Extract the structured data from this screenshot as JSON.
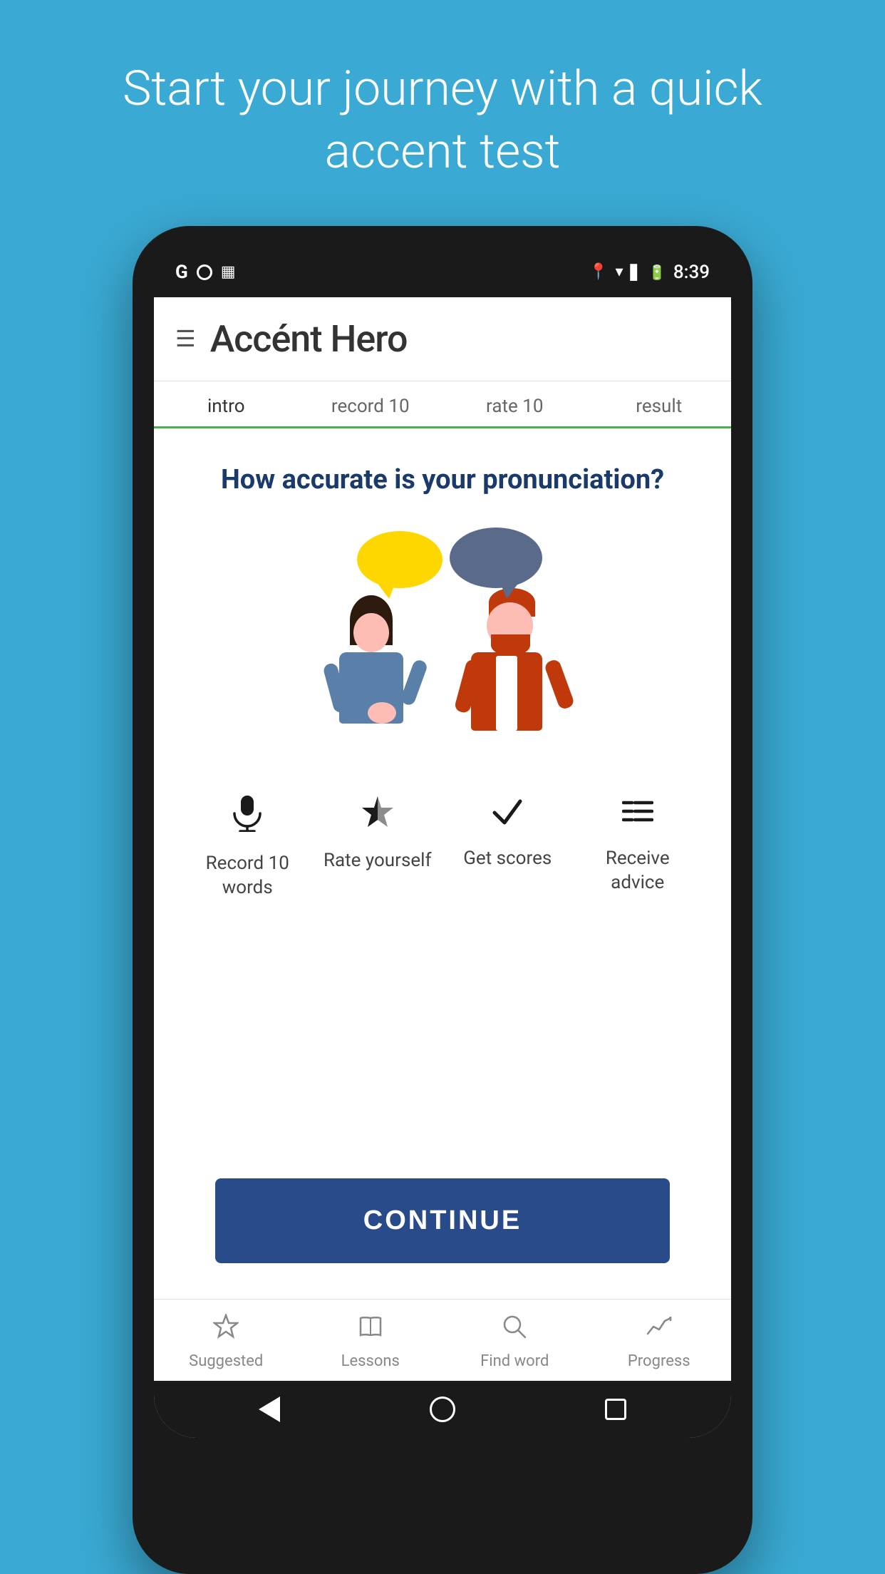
{
  "page": {
    "top_text": "Start your journey with a quick accent test",
    "app_title": "Accént Hero",
    "status_time": "8:39",
    "tabs": [
      {
        "id": "intro",
        "label": "intro",
        "active": true
      },
      {
        "id": "record",
        "label": "record 10",
        "active": false
      },
      {
        "id": "rate",
        "label": "rate 10",
        "active": false
      },
      {
        "id": "result",
        "label": "result",
        "active": false
      }
    ],
    "question": "How accurate is your pronunciation?",
    "steps": [
      {
        "icon": "🎤",
        "label": "Record 10 words",
        "name": "record"
      },
      {
        "icon": "⭐",
        "label": "Rate yourself",
        "name": "rate"
      },
      {
        "icon": "✓",
        "label": "Get scores",
        "name": "scores"
      },
      {
        "icon": "≡",
        "label": "Receive advice",
        "name": "advice"
      }
    ],
    "continue_button": "CONTINUE",
    "nav_items": [
      {
        "icon": "☆",
        "label": "Suggested",
        "name": "suggested"
      },
      {
        "icon": "📖",
        "label": "Lessons",
        "name": "lessons"
      },
      {
        "icon": "🔍",
        "label": "Find word",
        "name": "find-word"
      },
      {
        "icon": "📈",
        "label": "Progress",
        "name": "progress"
      }
    ]
  }
}
